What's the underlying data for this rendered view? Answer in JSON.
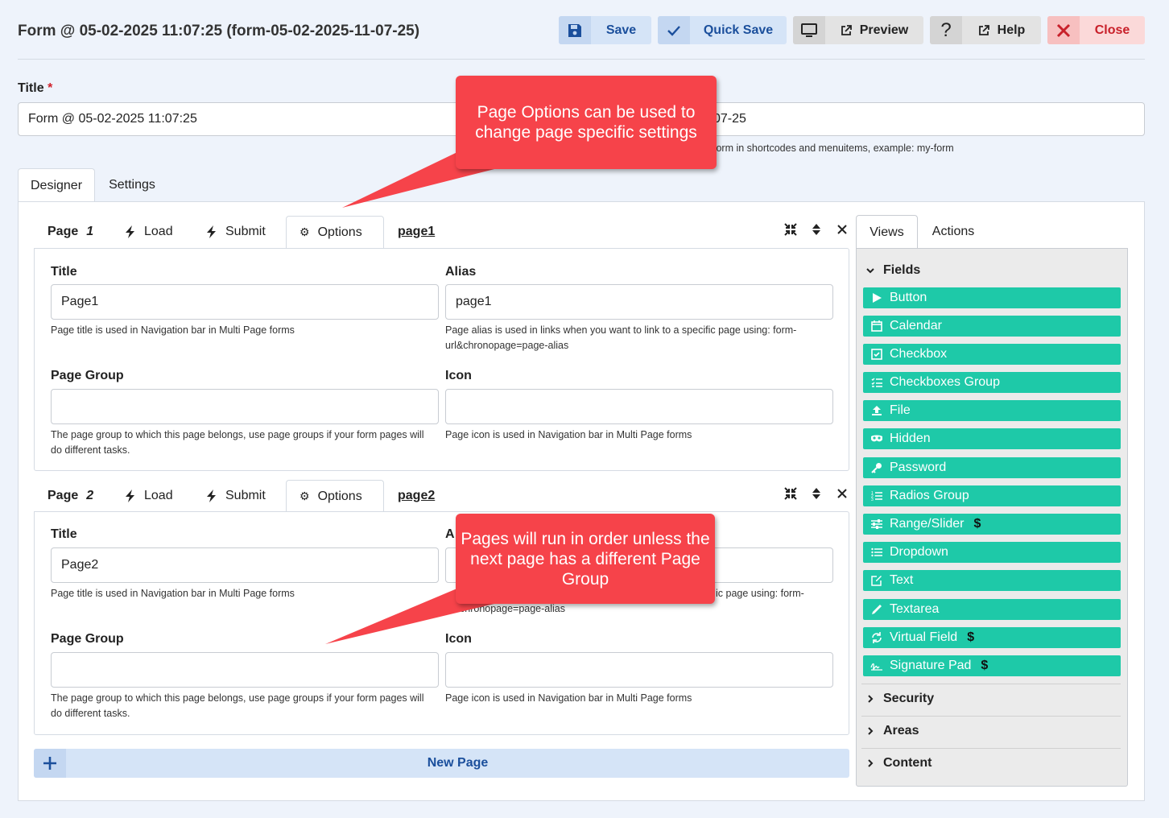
{
  "header": {
    "form_title": "Form @ 05-02-2025 11:07:25 (form-05-02-2025-11-07-25)",
    "buttons": {
      "save": "Save",
      "quick_save": "Quick Save",
      "preview": "Preview",
      "help": "Help",
      "close": "Close"
    }
  },
  "title_field": {
    "label": "Title",
    "required_mark": "*",
    "value": "Form @ 05-02-2025 11:07:25",
    "alias_value_visible": "07-25",
    "alias_hint_visible": "form in shortcodes and menuitems, example: my-form"
  },
  "main_tabs": {
    "designer": "Designer",
    "settings": "Settings"
  },
  "pages": [
    {
      "page_label": "Page",
      "number": "1",
      "tabs": {
        "load": "Load",
        "submit": "Submit",
        "options": "Options"
      },
      "alias_link": "page1",
      "title_label": "Title",
      "title_value": "Page1",
      "title_hint": "Page title is used in Navigation bar in Multi Page forms",
      "alias_label": "Alias",
      "alias_value": "page1",
      "alias_hint": "Page alias is used in links when you want to link to a specific page using: form-url&chronopage=page-alias",
      "group_label": "Page Group",
      "group_value": "",
      "group_hint": "The page group to which this page belongs, use page groups if your form pages will do different tasks.",
      "icon_label": "Icon",
      "icon_value": "",
      "icon_hint": "Page icon is used in Navigation bar in Multi Page forms"
    },
    {
      "page_label": "Page",
      "number": "2",
      "tabs": {
        "load": "Load",
        "submit": "Submit",
        "options": "Options"
      },
      "alias_link": "page2",
      "title_label": "Title",
      "title_value": "Page2",
      "title_hint": "Page title is used in Navigation bar in Multi Page forms",
      "alias_label_visible": "A",
      "alias_hint_visible_right": "ic page using: form-",
      "alias_hint_visible_left": "chronopage=page-alias",
      "group_label": "Page Group",
      "group_value": "",
      "group_hint": "The page group to which this page belongs, use page groups if your form pages will do different tasks.",
      "icon_label": "Icon",
      "icon_value": "",
      "icon_hint": "Page icon is used in Navigation bar in Multi Page forms"
    }
  ],
  "new_page": "New Page",
  "sidebar": {
    "tabs": {
      "views": "Views",
      "actions": "Actions"
    },
    "sections": {
      "fields": "Fields",
      "security": "Security",
      "areas": "Areas",
      "content": "Content"
    },
    "fields": [
      {
        "label": "Button",
        "icon": "play-icon",
        "paid": false
      },
      {
        "label": "Calendar",
        "icon": "calendar-icon",
        "paid": false
      },
      {
        "label": "Checkbox",
        "icon": "checkbox-icon",
        "paid": false
      },
      {
        "label": "Checkboxes Group",
        "icon": "list-check-icon",
        "paid": false
      },
      {
        "label": "File",
        "icon": "upload-icon",
        "paid": false
      },
      {
        "label": "Hidden",
        "icon": "mask-icon",
        "paid": false
      },
      {
        "label": "Password",
        "icon": "key-icon",
        "paid": false
      },
      {
        "label": "Radios Group",
        "icon": "list-ol-icon",
        "paid": false
      },
      {
        "label": "Range/Slider",
        "icon": "sliders-icon",
        "paid": true
      },
      {
        "label": "Dropdown",
        "icon": "list-icon",
        "paid": false
      },
      {
        "label": "Text",
        "icon": "edit-icon",
        "paid": false
      },
      {
        "label": "Textarea",
        "icon": "pen-icon",
        "paid": false
      },
      {
        "label": "Virtual Field",
        "icon": "sync-icon",
        "paid": true
      },
      {
        "label": "Signature Pad",
        "icon": "signature-icon",
        "paid": true
      }
    ],
    "paid_mark": "$"
  },
  "callouts": {
    "first": "Page Options can be used to change page specific settings",
    "second": "Pages will run in order unless the next page has a different Page Group"
  },
  "colors": {
    "page_bg": "#eef3fb",
    "field_green": "#1ec9a8",
    "blue_btn": "#d5e4f7",
    "close_btn": "#fbd9d9",
    "callout_red": "#f6434a"
  }
}
